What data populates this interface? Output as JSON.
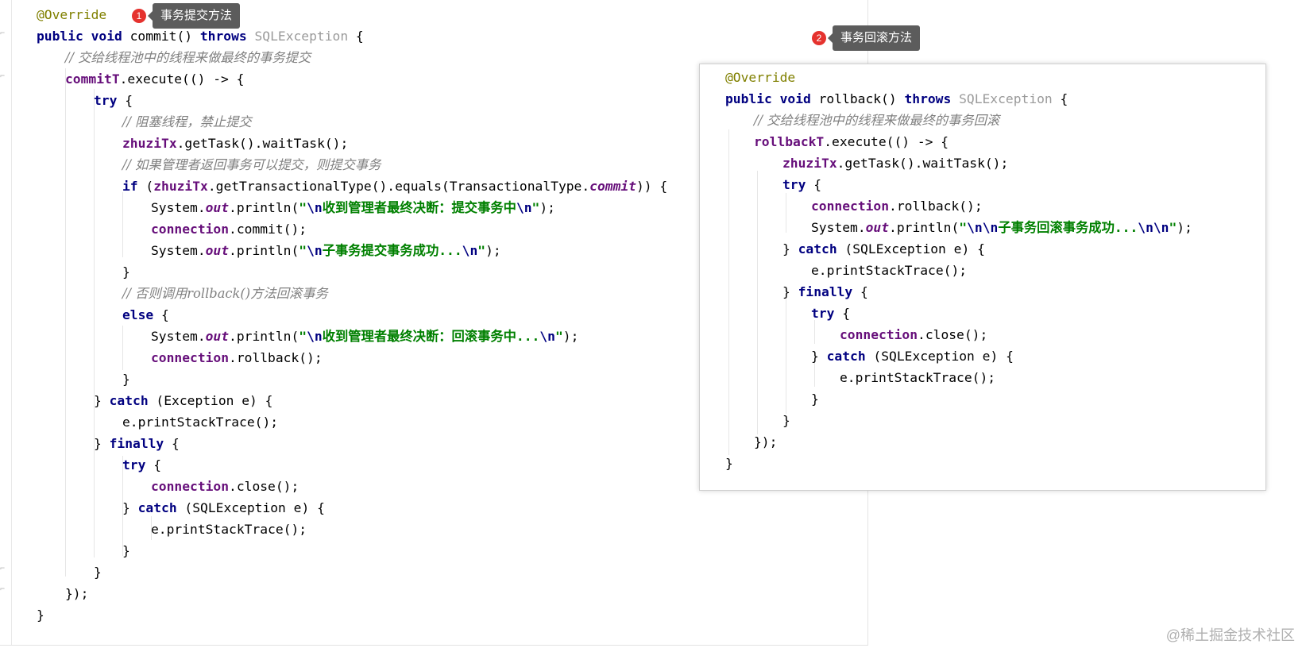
{
  "callouts": [
    {
      "number": "1",
      "label": "事务提交方法"
    },
    {
      "number": "2",
      "label": "事务回滚方法"
    }
  ],
  "commit_code": {
    "l1": {
      "a": "@Override"
    },
    "l2": {
      "a": "public void",
      "b": " commit() ",
      "c": "throws",
      "d": " SQLException",
      "e": " {"
    },
    "l3": {
      "a": "// 交给线程池中的线程来做最终的事务提交"
    },
    "l4": {
      "a": "commitT",
      "b": ".execute(() -> {"
    },
    "l5": {
      "a": "try",
      "b": " {"
    },
    "l6": {
      "a": "// 阻塞线程，禁止提交"
    },
    "l7": {
      "a": "zhuziTx",
      "b": ".getTask().waitTask();"
    },
    "l8": {
      "a": "// 如果管理者返回事务可以提交，则提交事务"
    },
    "l9": {
      "a": "if",
      "b": " (",
      "c": "zhuziTx",
      "d": ".getTransactionalType().equals(TransactionalType.",
      "e": "commit",
      "f": ")) {"
    },
    "l10": {
      "a": "System.",
      "b": "out",
      "c": ".println(",
      "d": "\"",
      "e": "\\n",
      "f": "收到管理者最终决断：提交事务中",
      "g": "\\n",
      "h": "\"",
      "i": ");"
    },
    "l11": {
      "a": "connection",
      "b": ".commit();"
    },
    "l12": {
      "a": "System.",
      "b": "out",
      "c": ".println(",
      "d": "\"",
      "e": "\\n",
      "f": "子事务提交事务成功...",
      "g": "\\n",
      "h": "\"",
      "i": ");"
    },
    "l13": {
      "a": "}"
    },
    "l14": {
      "a": "// 否则调用rollback()方法回滚事务"
    },
    "l15": {
      "a": "else",
      "b": " {"
    },
    "l16": {
      "a": "System.",
      "b": "out",
      "c": ".println(",
      "d": "\"",
      "e": "\\n",
      "f": "收到管理者最终决断：回滚事务中...",
      "g": "\\n",
      "h": "\"",
      "i": ");"
    },
    "l17": {
      "a": "connection",
      "b": ".rollback();"
    },
    "l18": {
      "a": "}"
    },
    "l19": {
      "a": "} ",
      "b": "catch",
      "c": " (Exception e) {"
    },
    "l20": {
      "a": "e.printStackTrace();"
    },
    "l21": {
      "a": "} ",
      "b": "finally",
      "c": " {"
    },
    "l22": {
      "a": "try",
      "b": " {"
    },
    "l23": {
      "a": "connection",
      "b": ".close();"
    },
    "l24": {
      "a": "} ",
      "b": "catch",
      "c": " (SQLException e) {"
    },
    "l25": {
      "a": "e.printStackTrace();"
    },
    "l26": {
      "a": "}"
    },
    "l27": {
      "a": "}"
    },
    "l28": {
      "a": "});"
    },
    "l29": {
      "a": "}"
    }
  },
  "rollback_code": {
    "l1": {
      "a": "@Override"
    },
    "l2": {
      "a": "public void",
      "b": " rollback() ",
      "c": "throws",
      "d": " SQLException",
      "e": " {"
    },
    "l3": {
      "a": "// 交给线程池中的线程来做最终的事务回滚"
    },
    "l4": {
      "a": "rollbackT",
      "b": ".execute(() -> {"
    },
    "l5": {
      "a": "zhuziTx",
      "b": ".getTask().waitTask();"
    },
    "l6": {
      "a": "try",
      "b": " {"
    },
    "l7": {
      "a": "connection",
      "b": ".rollback();"
    },
    "l8": {
      "a": "System.",
      "b": "out",
      "c": ".println(",
      "d": "\"",
      "e": "\\n\\n",
      "f": "子事务回滚事务成功...",
      "g": "\\n\\n",
      "h": "\"",
      "i": ");"
    },
    "l9": {
      "a": "} ",
      "b": "catch",
      "c": " (SQLException e) {"
    },
    "l10": {
      "a": "e.printStackTrace();"
    },
    "l11": {
      "a": "} ",
      "b": "finally",
      "c": " {"
    },
    "l12": {
      "a": "try",
      "b": " {"
    },
    "l13": {
      "a": "connection",
      "b": ".close();"
    },
    "l14": {
      "a": "} ",
      "b": "catch",
      "c": " (SQLException e) {"
    },
    "l15": {
      "a": "e.printStackTrace();"
    },
    "l16": {
      "a": "}"
    },
    "l17": {
      "a": "}"
    },
    "l18": {
      "a": "});"
    },
    "l19": {
      "a": "}"
    }
  },
  "watermark": "@稀土掘金技术社区"
}
